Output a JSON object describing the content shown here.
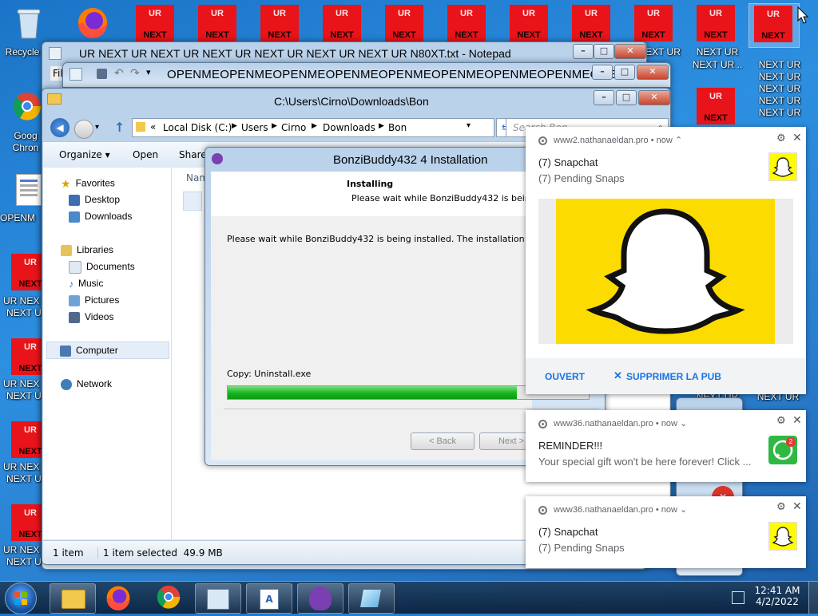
{
  "desktop": {
    "left_icons": {
      "recycle_bin": "Recycle",
      "chrome_a": "Goog",
      "chrome_b": "Chron",
      "openme": "OPENM",
      "ur_next_1": "UR NEX",
      "ur_next_1b": "NEXT U",
      "ur_next_2": "UR NEX",
      "ur_next_2b": "NEXT U",
      "ur_next_3": "UR NEX",
      "ur_next_3b": "NEXT U",
      "ur_next_4": "UR NEX",
      "ur_next_4b": "NEXT U"
    },
    "ur_icon_top": "UR",
    "ur_icon_bottom": "NEXT",
    "right_label_a": "NEXT UR",
    "right_label_b": "NEXT UR",
    "right_label_c": "NEXT UR",
    "right_label_d": "NEXT UR",
    "right_label_e": "NEXT UR",
    "right_label_f": "EXT UR",
    "right_label_g": "NEXT UR ..",
    "right_label_h": "NEXT UR",
    "right_label_i": "NEXT UR ...",
    "right_label_j": "NEXT UR ..."
  },
  "notepad": {
    "title": "UR NEXT UR NEXT UR NEXT UR NEXT UR NEXT UR NEXT UR N80XT.txt - Notepad",
    "menu_file": "Fil"
  },
  "notepad2": {
    "title": "OPENMEOPENMEOPENMEOPENMEOPENMEOPENMEOPENMEOPENMEOPEN..."
  },
  "explorer": {
    "title": "C:\\Users\\Cirno\\Downloads\\Bon",
    "breadcrumb": [
      "Local Disk (C:)",
      "Users",
      "Cirno",
      "Downloads",
      "Bon"
    ],
    "search_placeholder": "Search Bon",
    "toolbar": {
      "organize": "Organize ▾",
      "open": "Open",
      "share": "Share"
    },
    "column_name": "Nam",
    "nav": {
      "favorites": "Favorites",
      "desktop": "Desktop",
      "downloads": "Downloads",
      "libraries": "Libraries",
      "documents": "Documents",
      "music": "Music",
      "pictures": "Pictures",
      "videos": "Videos",
      "computer": "Computer",
      "network": "Network"
    },
    "status": {
      "count": "1 item",
      "selected": "1 item selected  49.9 MB"
    }
  },
  "installer": {
    "title": "BonziBuddy432 4 Installation",
    "heading": "Installing",
    "subheading": "Please wait while BonziBuddy432 is being inst",
    "body": "Please wait while BonziBuddy432 is being installed. The installation will take se",
    "status": "Copy: Uninstall.exe",
    "progress": 0.8,
    "back": "< Back",
    "next": "Next >"
  },
  "notifications": [
    {
      "source": "www2.nathanaeldan.pro",
      "when": "now",
      "chev": "⌃",
      "title": "(7) Snapchat",
      "body": "(7) Pending Snaps",
      "action1": "OUVERT",
      "action2": "SUPPRIMER LA PUB"
    },
    {
      "source": "www36.nathanaeldan.pro",
      "when": "now",
      "chev": "⌄",
      "title": "REMINDER!!!",
      "body": "Your special gift won't be here forever! Click ...",
      "badge": "2"
    },
    {
      "source": "www36.nathanaeldan.pro",
      "when": "now",
      "chev": "⌄",
      "title": "(7) Snapchat",
      "body": "(7) Pending Snaps"
    }
  ],
  "taskbar": {
    "time": "12:41 AM",
    "date": "4/2/2022"
  },
  "colors": {
    "progress": "#22c82a",
    "link": "#1a73e8",
    "snap_yellow": "#fffc00",
    "ur_red": "#e8141a"
  }
}
